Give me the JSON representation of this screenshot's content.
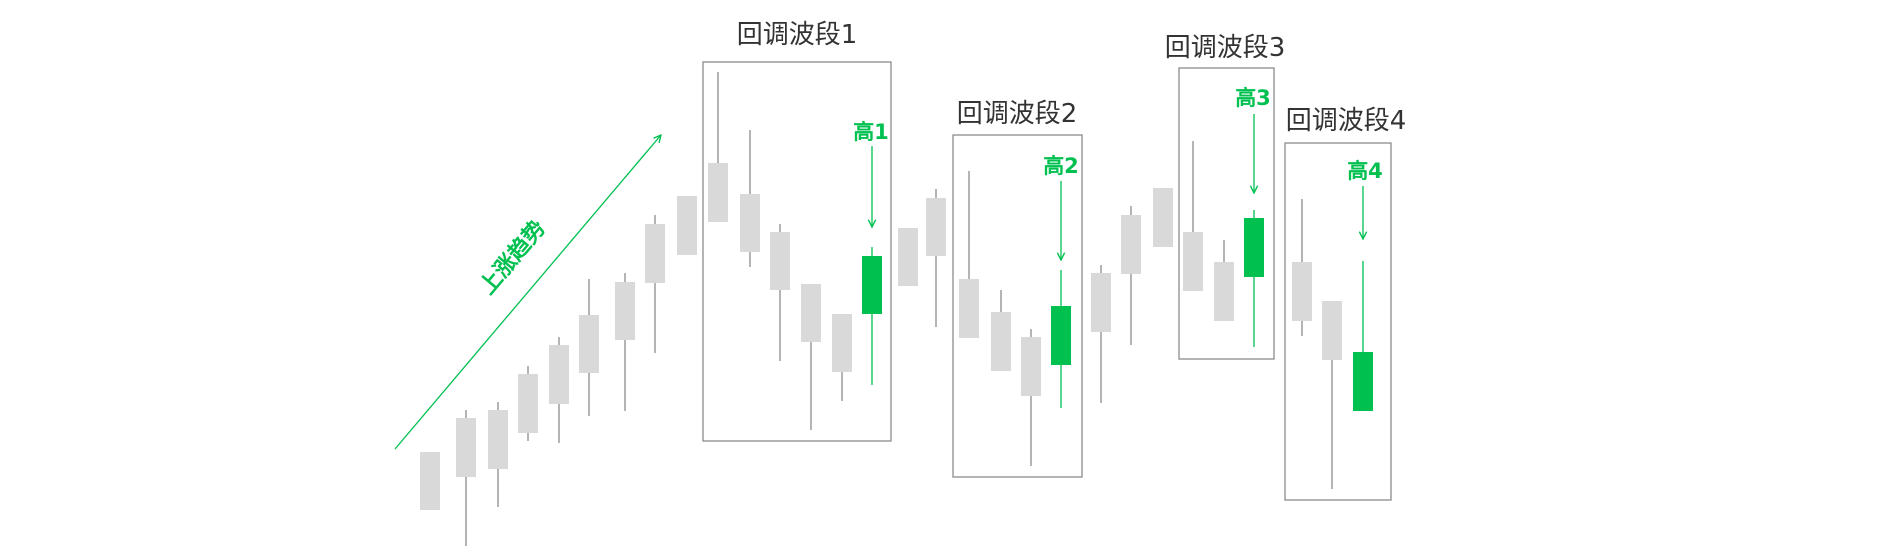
{
  "colors": {
    "neutral_candle": "#d9d9d9",
    "wick": "#8c8c8c",
    "highlight_candle": "#00c050",
    "box": "#8c8c8c",
    "title": "#333333"
  },
  "trend_label": "上涨趋势",
  "candles_note_fields": [
    "high",
    "body_top",
    "body_bottom",
    "low",
    "type"
  ],
  "candles": [
    [
      10.8,
      10.8,
      5.0,
      5.0,
      "gray"
    ],
    [
      15.0,
      14.2,
      8.3,
      1.4,
      "gray"
    ],
    [
      15.8,
      15.0,
      9.1,
      5.3,
      "gray"
    ],
    [
      19.4,
      18.6,
      12.7,
      11.9,
      "gray"
    ],
    [
      22.3,
      21.5,
      15.6,
      11.7,
      "gray"
    ],
    [
      28.1,
      24.5,
      18.7,
      14.4,
      "gray"
    ],
    [
      28.7,
      27.8,
      22.0,
      14.9,
      "gray"
    ],
    [
      34.5,
      33.6,
      27.7,
      20.7,
      "gray"
    ],
    [
      36.4,
      36.4,
      30.5,
      30.5,
      "gray"
    ],
    [
      48.8,
      39.7,
      33.8,
      33.8,
      "gray"
    ],
    [
      43.0,
      36.6,
      30.8,
      29.3,
      "gray"
    ],
    [
      33.6,
      32.8,
      27.0,
      19.9,
      "gray"
    ],
    [
      27.6,
      27.6,
      21.8,
      13.0,
      "gray"
    ],
    [
      24.6,
      24.6,
      18.8,
      15.9,
      "gray"
    ],
    [
      31.3,
      30.4,
      24.6,
      17.5,
      "green"
    ],
    [
      33.2,
      33.2,
      27.4,
      27.4,
      "gray"
    ],
    [
      37.1,
      36.2,
      30.4,
      23.3,
      "gray"
    ],
    [
      38.9,
      28.1,
      22.2,
      22.2,
      "gray"
    ],
    [
      27.0,
      24.8,
      18.9,
      18.9,
      "gray"
    ],
    [
      23.1,
      22.3,
      16.4,
      9.4,
      "gray"
    ],
    [
      29.0,
      25.4,
      19.5,
      15.2,
      "green"
    ],
    [
      29.5,
      28.7,
      22.8,
      15.7,
      "gray"
    ],
    [
      35.4,
      34.5,
      28.6,
      21.5,
      "gray"
    ],
    [
      37.2,
      37.2,
      31.3,
      31.3,
      "gray"
    ],
    [
      41.9,
      32.8,
      26.9,
      26.9,
      "gray"
    ],
    [
      32.0,
      29.8,
      23.9,
      23.9,
      "gray"
    ],
    [
      35.0,
      34.2,
      28.3,
      21.3,
      "green"
    ],
    [
      36.1,
      29.8,
      23.9,
      22.4,
      "gray"
    ],
    [
      25.9,
      25.9,
      20.0,
      7.1,
      "gray"
    ],
    [
      29.9,
      20.8,
      14.9,
      14.9,
      "green"
    ]
  ],
  "segments": [
    {
      "title": "回调波段1",
      "high_label": "高1",
      "first_candle": 10,
      "last_candle": 15
    },
    {
      "title": "回调波段2",
      "high_label": "高2",
      "first_candle": 18,
      "last_candle": 21
    },
    {
      "title": "回调波段3",
      "high_label": "高3",
      "first_candle": 25,
      "last_candle": 27
    },
    {
      "title": "回调波段4",
      "high_label": "高4",
      "first_candle": 28,
      "last_candle": 30
    }
  ]
}
